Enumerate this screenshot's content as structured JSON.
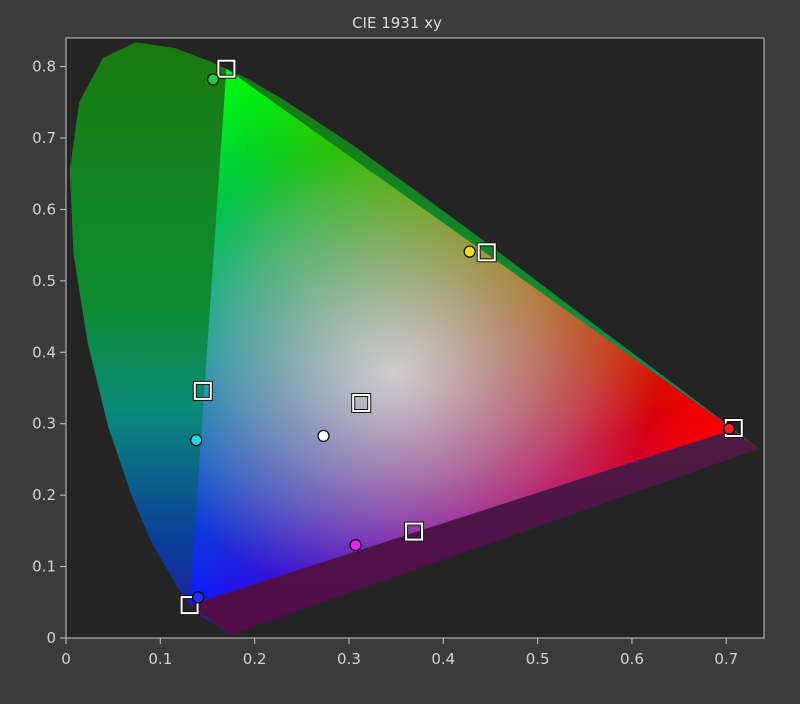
{
  "chart_data": {
    "type": "scatter",
    "title": "CIE 1931 xy",
    "xlabel": "",
    "ylabel": "",
    "xlim": [
      0,
      0.74
    ],
    "ylim": [
      0,
      0.84
    ],
    "x_ticks": [
      0,
      0.1,
      0.2,
      0.3,
      0.4,
      0.5,
      0.6,
      0.7
    ],
    "x_tick_labels": [
      "0",
      "0.1",
      "0.2",
      "0.3",
      "0.4",
      "0.5",
      "0.6",
      "0.7"
    ],
    "y_ticks": [
      0,
      0.1,
      0.2,
      0.3,
      0.4,
      0.5,
      0.6,
      0.7,
      0.8
    ],
    "y_tick_labels": [
      "0",
      "0.1",
      "0.2",
      "0.3",
      "0.4",
      "0.5",
      "0.6",
      "0.7",
      "0.8"
    ],
    "grid": false,
    "target_gamut": [
      [
        0.708,
        0.292
      ],
      [
        0.17,
        0.797
      ],
      [
        0.131,
        0.046
      ]
    ],
    "series": [
      {
        "marker": "square",
        "color": "#ffffff",
        "points": [
          {
            "x": 0.17,
            "y": 0.797
          },
          {
            "x": 0.446,
            "y": 0.54
          },
          {
            "x": 0.145,
            "y": 0.346
          },
          {
            "x": 0.313,
            "y": 0.329
          },
          {
            "x": 0.708,
            "y": 0.294
          },
          {
            "x": 0.369,
            "y": 0.149
          },
          {
            "x": 0.131,
            "y": 0.046
          }
        ]
      },
      {
        "marker": "circle",
        "points": [
          {
            "x": 0.156,
            "y": 0.782,
            "color": "#22cc44"
          },
          {
            "x": 0.428,
            "y": 0.541,
            "color": "#f0e020"
          },
          {
            "x": 0.138,
            "y": 0.277,
            "color": "#22dddd"
          },
          {
            "x": 0.273,
            "y": 0.283,
            "color": "#ffffff"
          },
          {
            "x": 0.703,
            "y": 0.293,
            "color": "#ee2222"
          },
          {
            "x": 0.307,
            "y": 0.13,
            "color": "#ee22ee"
          },
          {
            "x": 0.14,
            "y": 0.057,
            "color": "#2233ff"
          }
        ]
      }
    ],
    "colors": {
      "page_background": "#3b3b3b",
      "plot_background": "#242424",
      "axis": "#c8c8c8"
    }
  }
}
